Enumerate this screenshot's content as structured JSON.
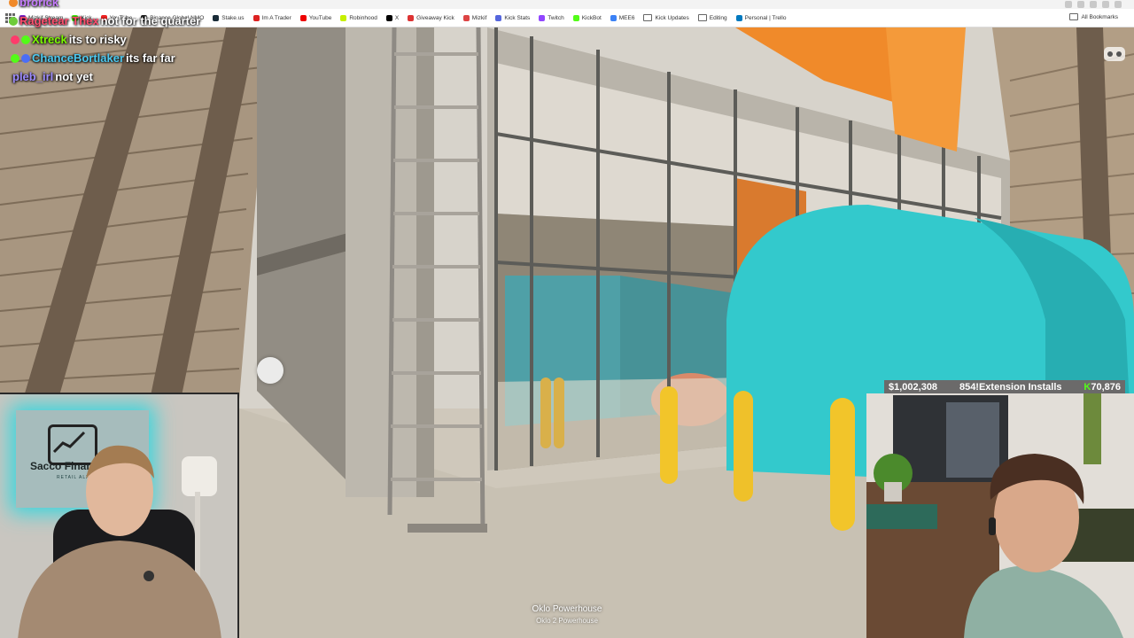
{
  "bookmarks": [
    {
      "label": "Mizkif Stream",
      "color": "#8a2be2"
    },
    {
      "label": "Kick",
      "color": "#53fc18"
    },
    {
      "label": "YouTube",
      "color": "#e22"
    },
    {
      "label": "Binance Global NMO",
      "color": "#222"
    },
    {
      "label": "Stake.us",
      "color": "#1a2c38"
    },
    {
      "label": "Im A Trader",
      "color": "#d22"
    },
    {
      "label": "YouTube",
      "color": "#e00"
    },
    {
      "label": "Robinhood",
      "color": "#c6f000"
    },
    {
      "label": "X",
      "color": "#000"
    },
    {
      "label": "Giveaway Kick",
      "color": "#d33"
    },
    {
      "label": "Mizkif",
      "color": "#d44"
    },
    {
      "label": "Kick Stats",
      "color": "#5566dd"
    },
    {
      "label": "Twitch",
      "color": "#9146ff"
    },
    {
      "label": "KickBot",
      "color": "#53fc18"
    },
    {
      "label": "MEE6",
      "color": "#3b82f6"
    },
    {
      "label": "Kick Updates",
      "color": "#888"
    },
    {
      "label": "Editing",
      "color": "#888"
    },
    {
      "label": "Personal | Trello",
      "color": "#0079bf"
    }
  ],
  "all_bookmarks": "All Bookmarks",
  "chat": [
    {
      "user": "brorick",
      "user_color": "#c77dff",
      "text": ""
    },
    {
      "user": "Ragetear Thex",
      "user_color": "#ff4d6d",
      "text": "not for the quarter"
    },
    {
      "user": "Xtreck",
      "user_color": "#7cfc00",
      "text": "its to risky"
    },
    {
      "user": "ChanceBortlaker",
      "user_color": "#4cc9f0",
      "text": "its far far"
    },
    {
      "user": "pleb_irl",
      "user_color": "#9d8cff",
      "text": "not yet"
    }
  ],
  "scene": {
    "caption_title": "Oklo Powerhouse",
    "caption_sub": "Oklo 2 Powerhouse"
  },
  "webcam_left": {
    "sign_name": "Sacco Financial",
    "sign_sub": "RETAIL ALPHA"
  },
  "stats": {
    "money": "$1,002,308",
    "installs": "854!Extension Installs",
    "kick_count": "70,876",
    "kick_glyph": "K"
  },
  "colors": {
    "accent_cyan": "#33c9cc",
    "orange": "#f08a2a",
    "kick_green": "#53fc18"
  }
}
